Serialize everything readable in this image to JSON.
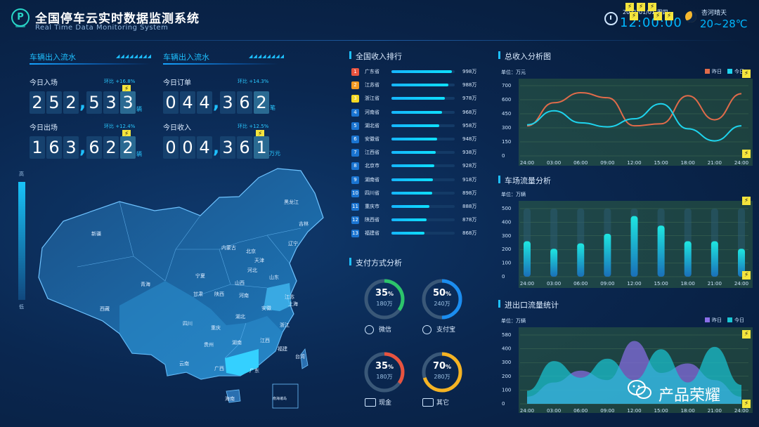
{
  "header": {
    "title": "全国停车云实时数据监测系统",
    "subtitle": "Real Time Data Monitoring System",
    "logo_letter": "P",
    "date": "2021/01/01 周四",
    "time": "12:00:00",
    "weather": "杏河晴天",
    "temp": "20~28℃"
  },
  "flow": {
    "left_title": "车辆出入流水",
    "right_title": "车辆出入流水",
    "today_in": {
      "label": "今日入场",
      "ratio": "环比 +16.8%",
      "digits": [
        "2",
        "5",
        "2",
        "5",
        "3",
        "3"
      ],
      "unit": "辆"
    },
    "today_out": {
      "label": "今日出场",
      "ratio": "环比 +12.4%",
      "digits": [
        "1",
        "6",
        "3",
        "6",
        "2",
        "2"
      ],
      "unit": "辆"
    },
    "today_orders": {
      "label": "今日订单",
      "ratio": "环比 +14.3%",
      "digits": [
        "0",
        "4",
        "4",
        "3",
        "6",
        "2"
      ],
      "unit": "笔"
    },
    "today_income": {
      "label": "今日收入",
      "ratio": "环比 +12.5%",
      "digits": [
        "0",
        "0",
        "4",
        "3",
        "6",
        "1"
      ],
      "unit": "万元"
    }
  },
  "map": {
    "scale_high": "高",
    "scale_low": "低",
    "provinces": [
      {
        "name": "黑龙江"
      },
      {
        "name": "吉林"
      },
      {
        "name": "辽宁"
      },
      {
        "name": "新疆"
      },
      {
        "name": "内蒙古"
      },
      {
        "name": "北京"
      },
      {
        "name": "天津"
      },
      {
        "name": "河北"
      },
      {
        "name": "山西"
      },
      {
        "name": "山东"
      },
      {
        "name": "宁夏"
      },
      {
        "name": "青海"
      },
      {
        "name": "甘肃"
      },
      {
        "name": "陕西"
      },
      {
        "name": "河南"
      },
      {
        "name": "江苏"
      },
      {
        "name": "安徽"
      },
      {
        "name": "上海"
      },
      {
        "name": "西藏"
      },
      {
        "name": "四川"
      },
      {
        "name": "湖北"
      },
      {
        "name": "浙江"
      },
      {
        "name": "重庆"
      },
      {
        "name": "湖南"
      },
      {
        "name": "江西"
      },
      {
        "name": "贵州"
      },
      {
        "name": "福建"
      },
      {
        "name": "云南"
      },
      {
        "name": "广西"
      },
      {
        "name": "广东"
      },
      {
        "name": "台湾"
      },
      {
        "name": "海南"
      },
      {
        "name": "南海诸岛"
      }
    ]
  },
  "ranking": {
    "title": "全国收入排行",
    "rows": [
      {
        "rank": "1",
        "name": "广东省",
        "value": "998万",
        "pct": 0.96,
        "color": "#e8533f"
      },
      {
        "rank": "2",
        "name": "江苏省",
        "value": "988万",
        "pct": 0.9,
        "color": "#f59a23"
      },
      {
        "rank": "3",
        "name": "浙江省",
        "value": "978万",
        "pct": 0.84,
        "color": "#f5d823"
      },
      {
        "rank": "4",
        "name": "河南省",
        "value": "968万",
        "pct": 0.8,
        "color": "#1a74d1"
      },
      {
        "rank": "5",
        "name": "湖北省",
        "value": "958万",
        "pct": 0.76,
        "color": "#1a74d1"
      },
      {
        "rank": "6",
        "name": "安徽省",
        "value": "948万",
        "pct": 0.72,
        "color": "#1a74d1"
      },
      {
        "rank": "7",
        "name": "江西省",
        "value": "938万",
        "pct": 0.7,
        "color": "#1a74d1"
      },
      {
        "rank": "8",
        "name": "北京市",
        "value": "928万",
        "pct": 0.68,
        "color": "#1a74d1"
      },
      {
        "rank": "9",
        "name": "湖南省",
        "value": "918万",
        "pct": 0.66,
        "color": "#1a74d1"
      },
      {
        "rank": "10",
        "name": "四川省",
        "value": "898万",
        "pct": 0.64,
        "color": "#1a74d1"
      },
      {
        "rank": "11",
        "name": "重庆市",
        "value": "888万",
        "pct": 0.6,
        "color": "#1a74d1"
      },
      {
        "rank": "12",
        "name": "陕西省",
        "value": "878万",
        "pct": 0.56,
        "color": "#1a74d1"
      },
      {
        "rank": "13",
        "name": "福建省",
        "value": "868万",
        "pct": 0.52,
        "color": "#1a74d1"
      }
    ]
  },
  "payment": {
    "title": "支付方式分析",
    "items": [
      {
        "pct": "35",
        "pct_sym": "%",
        "amount": "180万",
        "label": "微信",
        "fraction": 0.35,
        "color": "#2cc56b"
      },
      {
        "pct": "50",
        "pct_sym": "%",
        "amount": "240万",
        "label": "支付宝",
        "fraction": 0.5,
        "color": "#1b8df0"
      },
      {
        "pct": "35",
        "pct_sym": "%",
        "amount": "180万",
        "label": "现金",
        "fraction": 0.35,
        "color": "#e8533f"
      },
      {
        "pct": "70",
        "pct_sym": "%",
        "amount": "280万",
        "label": "其它",
        "fraction": 0.7,
        "color": "#f5b323"
      }
    ]
  },
  "chart_data": [
    {
      "type": "line",
      "title": "总收入分析图",
      "unit_label": "单位：万元",
      "categories": [
        "24:00",
        "03:00",
        "06:00",
        "09:00",
        "12:00",
        "15:00",
        "18:00",
        "21:00",
        "24:00"
      ],
      "yticks": [
        "700",
        "600",
        "450",
        "300",
        "150",
        "0"
      ],
      "ylim": [
        0,
        700
      ],
      "series": [
        {
          "name": "昨日",
          "color": "#e06b4a",
          "values": [
            300,
            530,
            630,
            580,
            300,
            320,
            600,
            360,
            620
          ]
        },
        {
          "name": "今日",
          "color": "#1ed4ee",
          "values": [
            310,
            450,
            330,
            290,
            370,
            520,
            270,
            150,
            300
          ]
        }
      ]
    },
    {
      "type": "bar",
      "title": "车场流量分析",
      "unit_label": "单位：万辆",
      "categories": [
        "24:00",
        "03:00",
        "06:00",
        "09:00",
        "12:00",
        "15:00",
        "18:00",
        "21:00",
        "24:00"
      ],
      "yticks": [
        "500",
        "400",
        "300",
        "200",
        "100",
        "0"
      ],
      "ylim": [
        0,
        500
      ],
      "values": [
        260,
        205,
        245,
        315,
        445,
        375,
        260,
        260,
        205
      ]
    },
    {
      "type": "area",
      "title": "进出口流量统计",
      "unit_label": "单位：万辆",
      "categories": [
        "24:00",
        "03:00",
        "06:00",
        "09:00",
        "12:00",
        "15:00",
        "18:00",
        "21:00",
        "24:00"
      ],
      "yticks": [
        "580",
        "400",
        "300",
        "200",
        "100",
        "0"
      ],
      "ylim": [
        0,
        580
      ],
      "series": [
        {
          "name": "昨日",
          "color": "#8a6ee8",
          "values": [
            60,
            180,
            280,
            200,
            530,
            260,
            340,
            200,
            60
          ]
        },
        {
          "name": "今日",
          "color": "#19c6d4",
          "values": [
            110,
            360,
            220,
            380,
            200,
            460,
            180,
            480,
            160
          ]
        }
      ]
    }
  ],
  "watermark": "产品荣耀"
}
